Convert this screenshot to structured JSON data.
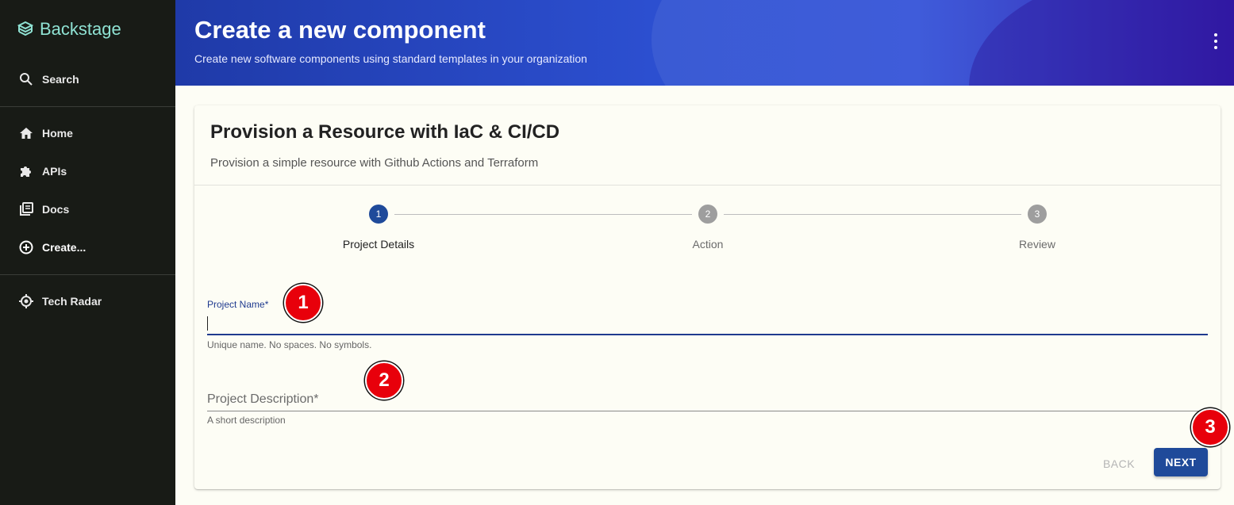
{
  "sidebar": {
    "logo_text": "Backstage",
    "search_label": "Search",
    "items": [
      {
        "label": "Home",
        "icon": "home-icon"
      },
      {
        "label": "APIs",
        "icon": "puzzle-icon"
      },
      {
        "label": "Docs",
        "icon": "library-books-icon"
      },
      {
        "label": "Create...",
        "icon": "add-circle-icon"
      }
    ],
    "plugins": [
      {
        "label": "Tech Radar",
        "icon": "radar-icon"
      }
    ]
  },
  "header": {
    "title": "Create a new component",
    "subtitle": "Create new software components using standard templates in your organization"
  },
  "template": {
    "title": "Provision a Resource with IaC & CI/CD",
    "description": "Provision a simple resource with Github Actions and Terraform"
  },
  "stepper": {
    "steps": [
      {
        "number": "1",
        "label": "Project Details",
        "active": true
      },
      {
        "number": "2",
        "label": "Action",
        "active": false
      },
      {
        "number": "3",
        "label": "Review",
        "active": false
      }
    ]
  },
  "form": {
    "project_name": {
      "label": "Project Name*",
      "value": "",
      "helper": "Unique name. No spaces. No symbols."
    },
    "project_description": {
      "placeholder": "Project Description*",
      "value": "",
      "helper": "A short description"
    }
  },
  "buttons": {
    "back": "BACK",
    "next": "NEXT"
  },
  "markers": [
    "1",
    "2",
    "3"
  ],
  "colors": {
    "sidebar_bg": "#181b16",
    "logo": "#8fe2d3",
    "primary": "#1f4a9a",
    "marker": "#e8000b"
  }
}
